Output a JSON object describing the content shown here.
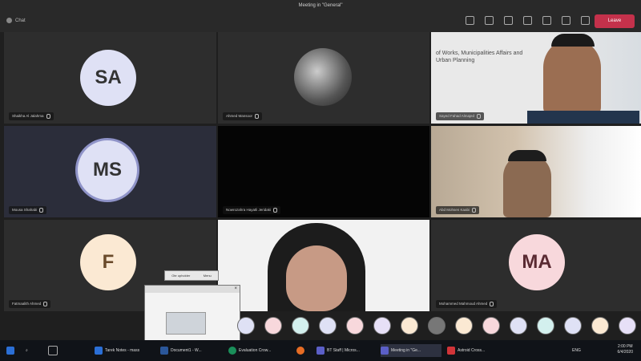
{
  "window": {
    "title": "Meeting in \"General\"",
    "back_label": "Chat",
    "leave_label": "Leave",
    "leave_color": "#c4314b"
  },
  "toolbar_icons": [
    "people-icon",
    "chat-icon",
    "hand-icon",
    "more-icon",
    "camera-icon",
    "mic-icon",
    "share-icon"
  ],
  "tiles": [
    {
      "type": "avatar",
      "initials": "SA",
      "name": "Shaikha Al Jalahma",
      "avatar_bg": "#dfe1f5"
    },
    {
      "type": "photo",
      "name": "Ahmed Mansoor"
    },
    {
      "type": "video",
      "name": "Sayed Fahad Almajed",
      "banner_text": "of Works, Municipalities Affairs and Urban Planning"
    },
    {
      "type": "avatar",
      "initials": "MS",
      "name": "Mousa Shahabi",
      "avatar_bg": "#dfe1f5"
    },
    {
      "type": "blank",
      "name": "Nowrozahra Hayatli Jeridaki"
    },
    {
      "type": "video",
      "name": "Abd Mohsen Kaabi"
    },
    {
      "type": "avatar",
      "initials": "F",
      "name": "Fatmaalith Ahmed",
      "avatar_bg": "#fbe9d3"
    },
    {
      "type": "video",
      "name": ""
    },
    {
      "type": "avatar",
      "initials": "MA",
      "name": "Mohammed Mahmoud Ahmed",
      "avatar_bg": "#f8d8dc"
    }
  ],
  "popup": {
    "tooltip_left": "Ote upholder",
    "tooltip_right": "Menu"
  },
  "participant_bubbles": 15,
  "taskbar": {
    "items": [
      {
        "label": "Tarek Notes - mass",
        "color": "#2b6fd6"
      },
      {
        "label": "Document1 - W...",
        "color": "#2b579a"
      },
      {
        "label": "Evaluation Crow...",
        "color": "#1a8f5a"
      },
      {
        "label": "",
        "color": "#e66c24"
      },
      {
        "label": "BT Staff | Micros...",
        "color": "#5b5fc7"
      },
      {
        "label": "Meeting in \"Ge...",
        "color": "#5b5fc7"
      },
      {
        "label": "Astroid Cross...",
        "color": "#d13438"
      }
    ],
    "time": "2:00 PM",
    "date": "6/4/2020",
    "lang": "ENG"
  }
}
